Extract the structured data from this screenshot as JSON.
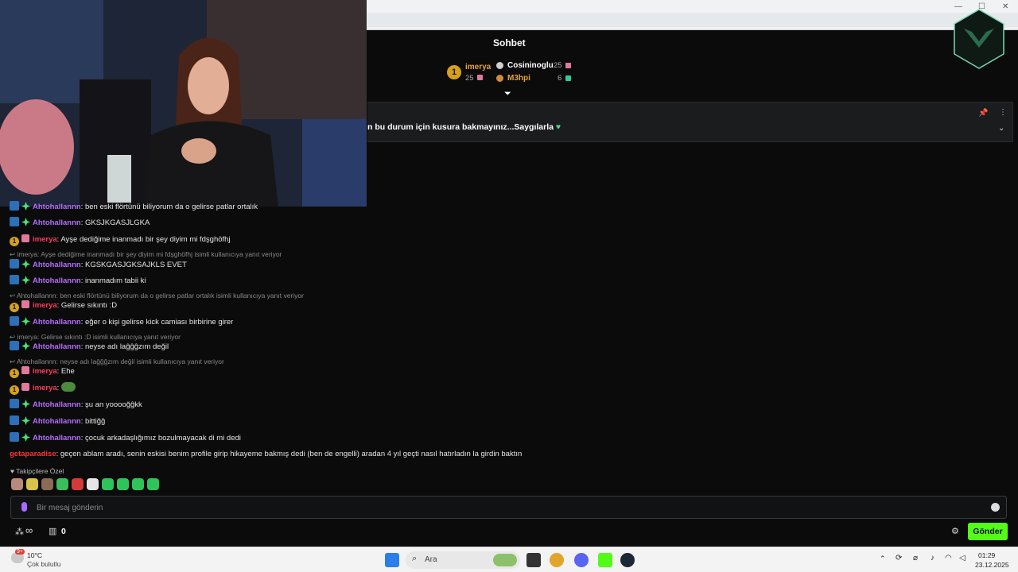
{
  "chat": {
    "title": "Sohbet",
    "top_donors": {
      "rank1": {
        "rank": "1",
        "name": "imerya",
        "amount": "25"
      },
      "rank2": {
        "name": "Cosininoglu",
        "amount": "25"
      },
      "rank3": {
        "name": "M3hpi",
        "amount": "6"
      }
    },
    "pinned_message": "n bu durum için kusura bakmayınız...Saygılarla",
    "messages": [
      {
        "kind": "msg",
        "user": "Ahtohallannn",
        "style": "purple",
        "badges": "blue-green",
        "text": ": ben eski flörtünü biliyorum da o gelirse patlar ortalık"
      },
      {
        "kind": "msg",
        "user": "Ahtohallannn",
        "style": "purple",
        "badges": "blue-green",
        "text": ": GKSJKGASJLGKA"
      },
      {
        "kind": "msg",
        "user": "imerya",
        "style": "red",
        "badges": "gold-pink",
        "text": ": Ayşe dediğime inanmadı bir şey diyim mi fdşghöfhj"
      },
      {
        "kind": "reply",
        "text": "imerya: Ayşe dediğime inanmadı bir şey diyim mi fdşghöfhj isimli kullanıcıya yanıt veriyor"
      },
      {
        "kind": "msg",
        "user": "Ahtohallannn",
        "style": "purple",
        "badges": "blue-green",
        "text": ": KGSKGASJGKSAJKLS EVET"
      },
      {
        "kind": "msg",
        "user": "Ahtohallannn",
        "style": "purple",
        "badges": "blue-green",
        "text": ": inanmadım tabii ki"
      },
      {
        "kind": "reply",
        "text": "Ahtohallannn: ben eski flörtünü biliyorum da o gelirse patlar ortalık isimli kullanıcıya yanıt veriyor"
      },
      {
        "kind": "msg",
        "user": "imerya",
        "style": "red",
        "badges": "gold-pink",
        "text": ": Gelirse sıkıntı :D"
      },
      {
        "kind": "msg",
        "user": "Ahtohallannn",
        "style": "purple",
        "badges": "blue-green",
        "text": ": eğer o kişi gelirse kick camiası birbirine girer"
      },
      {
        "kind": "reply",
        "text": "imerya: Gelirse sıkıntı :D isimli kullanıcıya yanıt veriyor"
      },
      {
        "kind": "msg",
        "user": "Ahtohallannn",
        "style": "purple",
        "badges": "blue-green",
        "text": ": neyse adı laĝĝĝzım değil"
      },
      {
        "kind": "reply",
        "text": "Ahtohallannn: neyse adı laĝĝĝzım değil isimli kullanıcıya yanıt veriyor"
      },
      {
        "kind": "msg",
        "user": "imerya",
        "style": "red",
        "badges": "gold-pink",
        "text": ": Ehe"
      },
      {
        "kind": "msg",
        "user": "imerya",
        "style": "red",
        "badges": "gold-pink",
        "text": ":",
        "emote": true
      },
      {
        "kind": "msg",
        "user": "Ahtohallannn",
        "style": "purple",
        "badges": "blue-green",
        "text": ": şu an yooooğĝkk"
      },
      {
        "kind": "msg",
        "user": "Ahtohallannn",
        "style": "purple",
        "badges": "blue-green",
        "text": ": bittiğĝ"
      },
      {
        "kind": "msg",
        "user": "Ahtohallannn",
        "style": "purple",
        "badges": "blue-green",
        "text": ": çocuk arkadaşlığımız bozulmayacak di mi dedi"
      },
      {
        "kind": "msg",
        "user": "getaparadise",
        "style": "red2",
        "badges": "",
        "text": ": geçen ablam aradı, senin eskisi benim profile girip hikayeme bakmış dedi (ben de engelli) aradan 4 yıl geçti nasıl hatırladın la girdin baktın"
      }
    ],
    "followers_label": "Takipçilere Özel",
    "input_placeholder": "Bir mesaj gönderin",
    "stats": {
      "infinity_label": "∞",
      "store_count": "0"
    },
    "send_label": "Gönder"
  },
  "taskbar": {
    "weather_temp": "10°C",
    "weather_desc": "Çok bulutlu",
    "weather_badge": "9+",
    "search_label": "Ara",
    "time": "01:29",
    "date": "23.12.2025"
  },
  "colors": {
    "accent": "#53fc18",
    "username_purple": "#b66cff",
    "username_red": "#ff3b5c"
  }
}
